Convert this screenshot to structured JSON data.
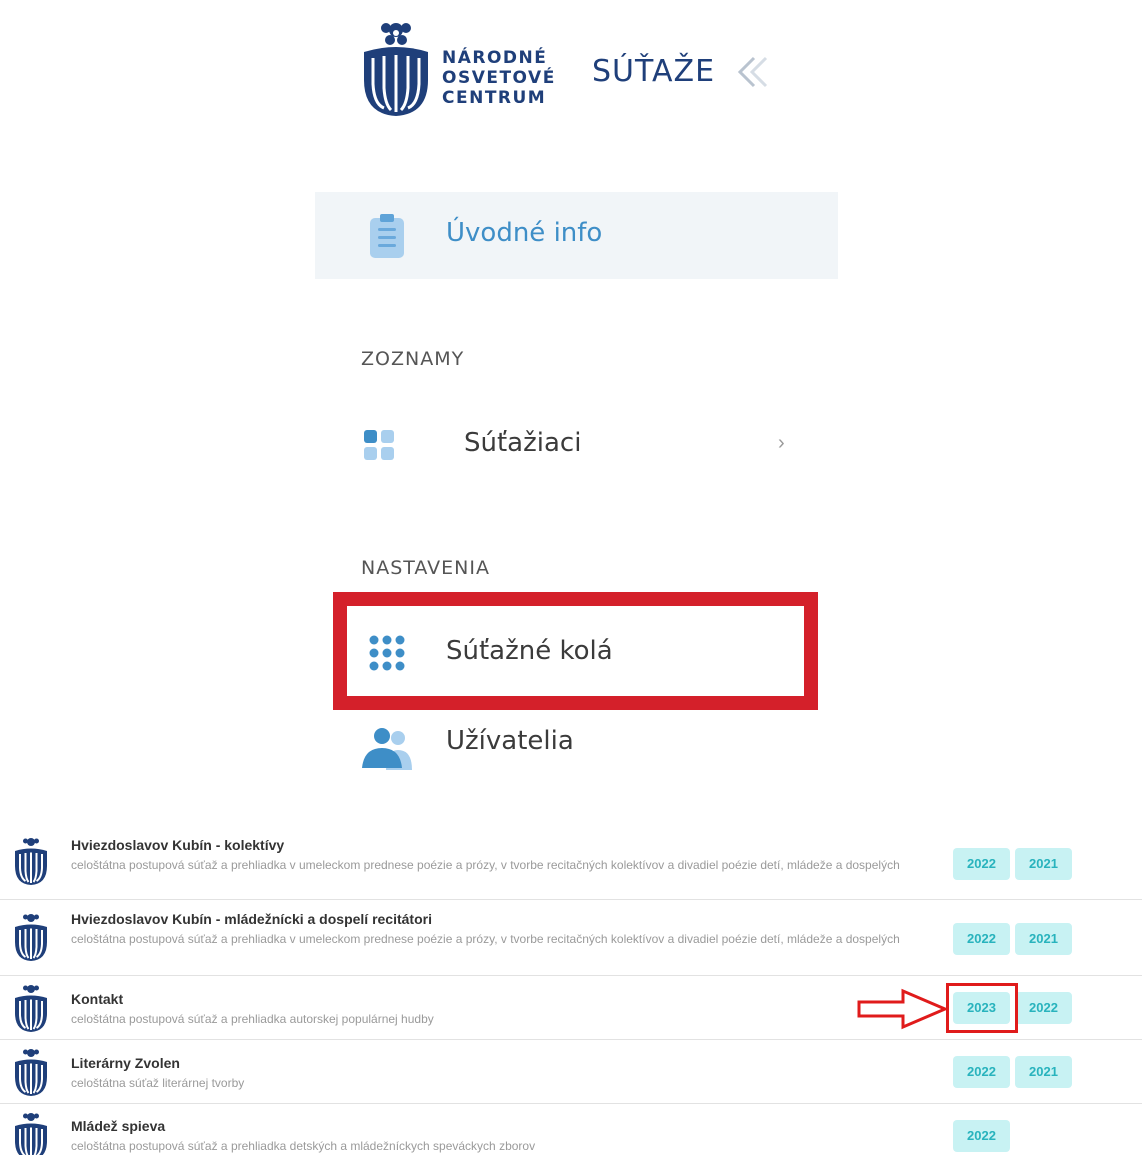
{
  "brand": {
    "org_line1": "NÁRODNÉ",
    "org_line2": "OSVETOVÉ",
    "org_line3": "CENTRUM",
    "app_title": "SÚŤAŽE",
    "logo_icon": "nos-logo-icon",
    "collapse_icon": "double-chevron-left-icon"
  },
  "sidebar": {
    "intro": {
      "label": "Úvodné info",
      "icon": "clipboard-icon"
    },
    "sections": [
      {
        "title": "ZOZNAMY",
        "items": [
          {
            "label": "Súťažiaci",
            "icon": "grid-squares-icon",
            "chevron": "›"
          }
        ]
      },
      {
        "title": "NASTAVENIA",
        "items": [
          {
            "label": "Súťažné kolá",
            "icon": "dots-grid-icon"
          },
          {
            "label": "Užívatelia",
            "icon": "users-icon"
          }
        ]
      }
    ]
  },
  "competitions": [
    {
      "title": "Hviezdoslavov Kubín - kolektívy",
      "description": "celoštátna postupová súťaž a prehliadka v umeleckom prednese poézie a prózy, v tvorbe recitačných kolektívov a divadiel poézie detí, mládeže a dospelých",
      "years": [
        "2022",
        "2021"
      ]
    },
    {
      "title": "Hviezdoslavov Kubín - mládežnícki a dospelí recitátori",
      "description": "celoštátna postupová súťaž a prehliadka v umeleckom prednese poézie a prózy, v tvorbe recitačných kolektívov a divadiel poézie detí, mládeže a dospelých",
      "years": [
        "2022",
        "2021"
      ]
    },
    {
      "title": "Kontakt",
      "description": "celoštátna postupová súťaž a prehliadka autorskej populárnej hudby",
      "years": [
        "2023",
        "2022"
      ]
    },
    {
      "title": "Literárny Zvolen",
      "description": "celoštátna súťaž literárnej tvorby",
      "years": [
        "2022",
        "2021"
      ]
    },
    {
      "title": "Mládež spieva",
      "description": "celoštátna postupová súťaž a prehliadka detských a mládežníckych speváckych zborov",
      "years": [
        "2022"
      ]
    }
  ],
  "colors": {
    "brand_blue": "#1f3f7a",
    "accent_blue": "#3e8ec7",
    "highlight_red": "#d4202a",
    "year_button_bg": "#c8f2f3",
    "year_button_text": "#28b3bd"
  }
}
